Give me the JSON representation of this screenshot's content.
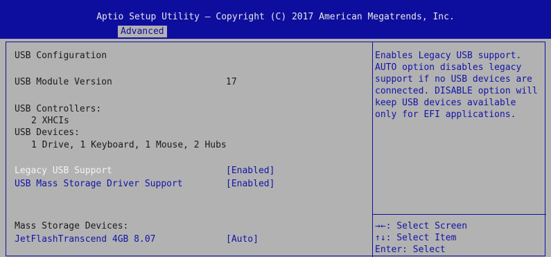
{
  "header": {
    "title": "Aptio Setup Utility – Copyright (C) 2017 American Megatrends, Inc.",
    "active_tab": "Advanced"
  },
  "main": {
    "section_title": "USB Configuration",
    "module_version_label": "USB Module Version",
    "module_version_value": "17",
    "controllers_label": "USB Controllers:",
    "controllers_value": "2 XHCIs",
    "devices_label": "USB Devices:",
    "devices_value": "1 Drive, 1 Keyboard, 1 Mouse, 2 Hubs",
    "legacy_usb_label": "Legacy USB Support",
    "legacy_usb_value": "[Enabled]",
    "mass_storage_driver_label": "USB Mass Storage Driver Support",
    "mass_storage_driver_value": "[Enabled]",
    "mass_storage_devices_label": "Mass Storage Devices:",
    "device1_label": "JetFlashTranscend 4GB 8.07",
    "device1_value": "[Auto]"
  },
  "help": {
    "lines": [
      "Enables Legacy USB support.",
      "AUTO option disables legacy",
      "support if no USB devices are",
      "connected. DISABLE option will",
      "keep USB devices available",
      "only for EFI applications."
    ],
    "keys": [
      "→←: Select Screen",
      "↑↓: Select Item",
      "Enter: Select"
    ]
  },
  "colors": {
    "header_bg": "#0e0e9e",
    "panel_bg": "#b2b2b2",
    "selected_text": "#f4f4f4",
    "option_text": "#1214a6"
  }
}
